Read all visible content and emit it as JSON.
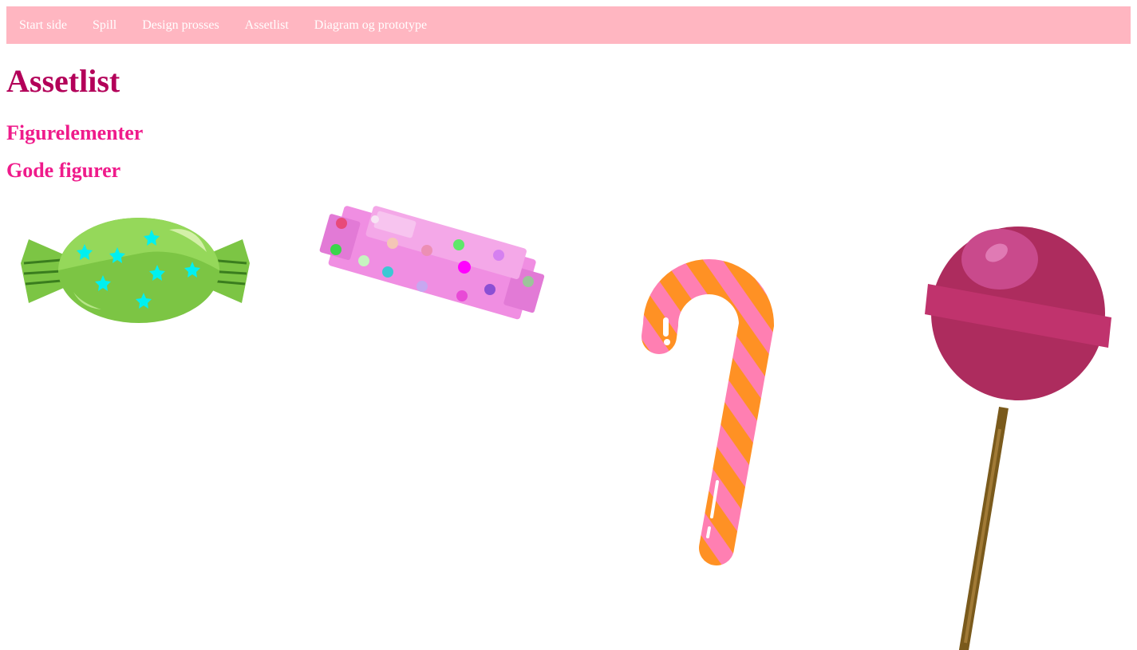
{
  "nav": {
    "items": [
      {
        "label": "Start side"
      },
      {
        "label": "Spill"
      },
      {
        "label": "Design prosses"
      },
      {
        "label": "Assetlist"
      },
      {
        "label": "Diagram og prototype"
      }
    ]
  },
  "page": {
    "title": "Assetlist",
    "section_1": "Figurelementer",
    "section_2": "Gode figurer"
  },
  "assets": [
    {
      "name": "green wrapped candy",
      "icon": "wrapped-candy-icon"
    },
    {
      "name": "pink candy bar",
      "icon": "candy-bar-icon"
    },
    {
      "name": "candy cane",
      "icon": "candy-cane-icon"
    },
    {
      "name": "lollipop",
      "icon": "lollipop-icon"
    }
  ],
  "colors": {
    "nav_bg": "#ffb6c1",
    "nav_text": "#ffffff",
    "title": "#b30059",
    "heading": "#ef1b8b"
  }
}
